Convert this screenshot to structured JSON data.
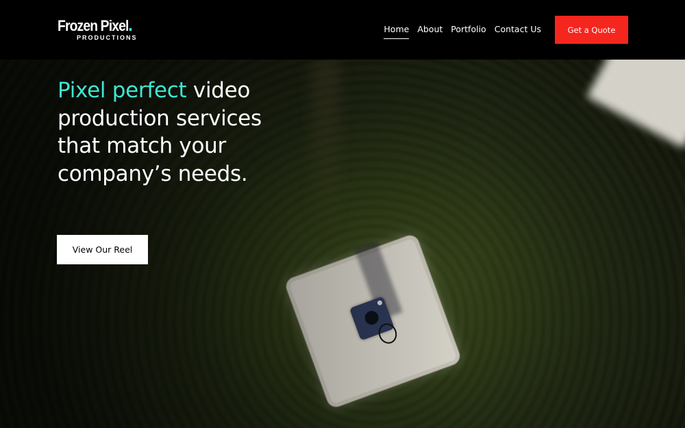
{
  "header": {
    "logo": {
      "main": "Frozen Pixel",
      "sub": "PRODUCTIONS"
    },
    "nav": [
      {
        "label": "Home",
        "active": true
      },
      {
        "label": "About",
        "active": false
      },
      {
        "label": "Portfolio",
        "active": false
      },
      {
        "label": "Contact Us",
        "active": false
      }
    ],
    "cta_label": "Get a Quote"
  },
  "hero": {
    "headline_accent": "Pixel perfect",
    "headline_rest": " video production services that match your company’s needs.",
    "button_label": "View Our Reel"
  },
  "colors": {
    "accent": "#3ee6d2",
    "cta": "#f5261e",
    "header_bg": "#000000"
  }
}
